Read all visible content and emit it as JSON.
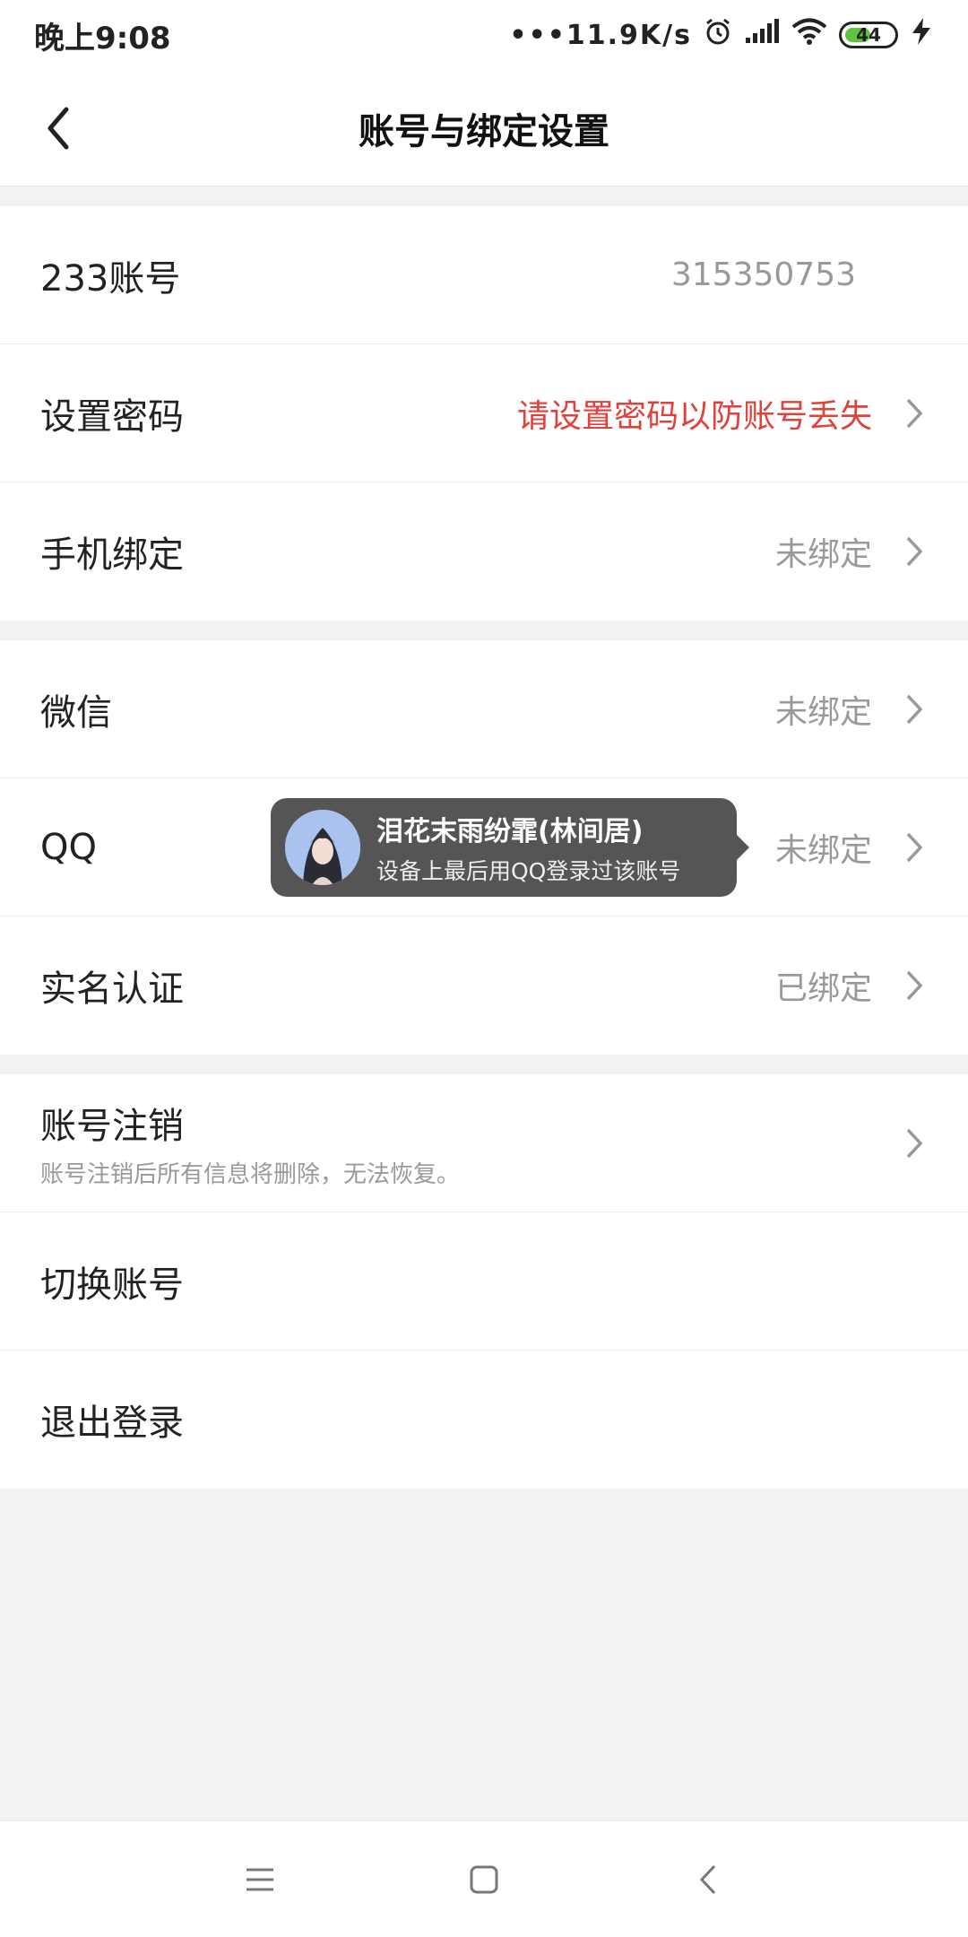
{
  "status_bar": {
    "time": "晚上9:08",
    "network_speed": "•••11.9K/s",
    "battery": "44"
  },
  "header": {
    "title": "账号与绑定设置"
  },
  "groups": [
    {
      "rows": [
        {
          "label": "233账号",
          "value": "315350753",
          "has_arrow": false
        },
        {
          "label": "设置密码",
          "value": "请设置密码以防账号丢失",
          "has_arrow": true,
          "value_color": "#e0413a"
        },
        {
          "label": "手机绑定",
          "value": "未绑定",
          "has_arrow": true
        }
      ]
    },
    {
      "rows": [
        {
          "label": "微信",
          "value": "未绑定",
          "has_arrow": true
        },
        {
          "label": "QQ",
          "value": "未绑定",
          "has_arrow": true
        },
        {
          "label": "实名认证",
          "value": "已绑定",
          "has_arrow": true
        }
      ]
    },
    {
      "rows": [
        {
          "label": "账号注销",
          "subtitle": "账号注销后所有信息将删除，无法恢复。",
          "has_arrow": true
        },
        {
          "label": "切换账号",
          "has_arrow": false
        },
        {
          "label": "退出登录",
          "has_arrow": false
        }
      ]
    }
  ],
  "qq_tooltip": {
    "name": "泪花末雨纷霏(林间居)",
    "description": "设备上最后用QQ登录过该账号"
  },
  "colors": {
    "accent_red": "#e0413a",
    "muted_text": "#999999",
    "background": "#f2f2f2"
  }
}
